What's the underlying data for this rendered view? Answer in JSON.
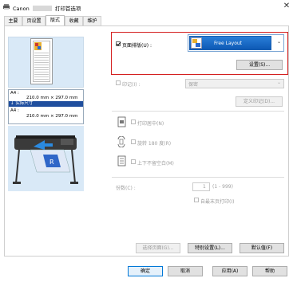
{
  "window": {
    "title": "Canon",
    "title_suffix": "打印首选项",
    "close_glyph": "✕"
  },
  "tabs": [
    {
      "label": "主要"
    },
    {
      "label": "页设置"
    },
    {
      "label": "版式"
    },
    {
      "label": "收藏"
    },
    {
      "label": "维护"
    }
  ],
  "preview": {
    "paper_line1": "A4 :",
    "paper_line2": "210.0 mm × 297.0 mm",
    "actual_size": "↓ 实际尺寸",
    "paper_line3": "A4 :",
    "paper_line4": "210.0 mm × 297.0 mm"
  },
  "layout": {
    "page_layout_label": "页面排版(U) :",
    "page_layout_checked": true,
    "selected_layout": "Free Layout",
    "settings_button": "设置(S)..."
  },
  "stamp": {
    "label": "印记(I) :",
    "value": "保密",
    "define_button": "定义印记(D)..."
  },
  "options": {
    "center_print": "打印居中(N)",
    "rotate_180": "旋转 180 度(R)",
    "mirror": "上下不留空白(M)"
  },
  "copies": {
    "label": "份数(C) :",
    "value": "1",
    "range": "(1 - 999)",
    "collate_label": "自最末页打印(I)"
  },
  "panel_buttons": {
    "select_pages": "选择页面(G)...",
    "special_settings": "特别设置(L)...",
    "defaults": "默认值(F)"
  },
  "footer": {
    "ok": "确定",
    "cancel": "取消",
    "apply": "应用(A)",
    "help": "帮助"
  },
  "colors": {
    "highlight_red": "#d42020",
    "accent_blue": "#1f4e9e",
    "preview_bg": "#d9e9f7"
  }
}
